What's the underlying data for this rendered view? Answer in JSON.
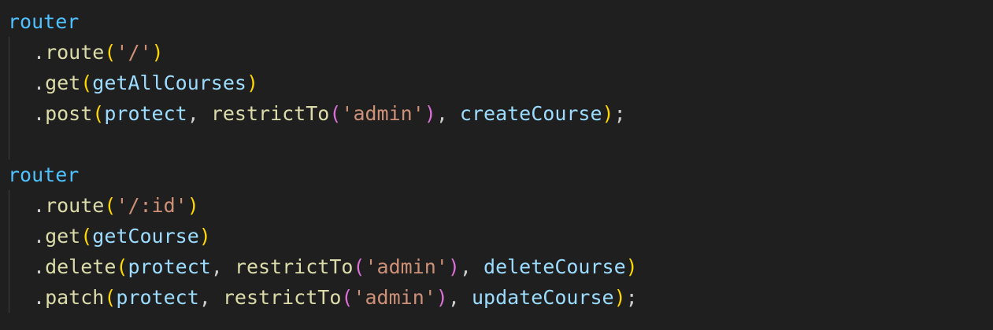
{
  "colors": {
    "background": "#1f1f1f",
    "variable": "#4fc1ff",
    "function": "#dcdcaa",
    "string": "#ce9178",
    "identifier": "#9cdcfe",
    "bracket_level1": "#ffd700",
    "bracket_level2": "#da70d6",
    "punctuation": "#cccccc"
  },
  "code": {
    "block1": {
      "object": "router",
      "route_method": "route",
      "route_path": "'/'",
      "get_method": "get",
      "get_handler": "getAllCourses",
      "post_method": "post",
      "post_mw1": "protect",
      "post_mw2": "restrictTo",
      "post_role": "'admin'",
      "post_handler": "createCourse"
    },
    "block2": {
      "object": "router",
      "route_method": "route",
      "route_path": "'/:id'",
      "get_method": "get",
      "get_handler": "getCourse",
      "delete_method": "delete",
      "delete_mw1": "protect",
      "delete_mw2": "restrictTo",
      "delete_role": "'admin'",
      "delete_handler": "deleteCourse",
      "patch_method": "patch",
      "patch_mw1": "protect",
      "patch_mw2": "restrictTo",
      "patch_role": "'admin'",
      "patch_handler": "updateCourse"
    }
  }
}
